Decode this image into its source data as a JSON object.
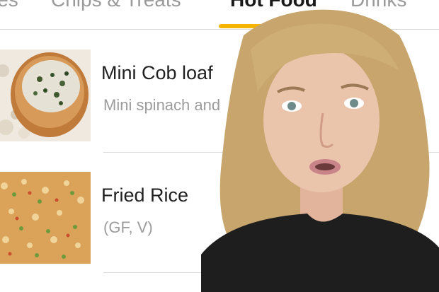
{
  "tabs": [
    {
      "label": "ies"
    },
    {
      "label": "Chips & Treats"
    },
    {
      "label": "Hot Food"
    },
    {
      "label": "Drinks"
    }
  ],
  "active_tab": "Hot Food",
  "menu_items": [
    {
      "title": "Mini Cob loaf",
      "description": "Mini spinach and"
    },
    {
      "title": "Fried Rice",
      "description": "(GF, V)"
    }
  ],
  "colors": {
    "accent": "#f4b400",
    "title": "#1f1f1f",
    "muted": "#9c9c9c"
  }
}
